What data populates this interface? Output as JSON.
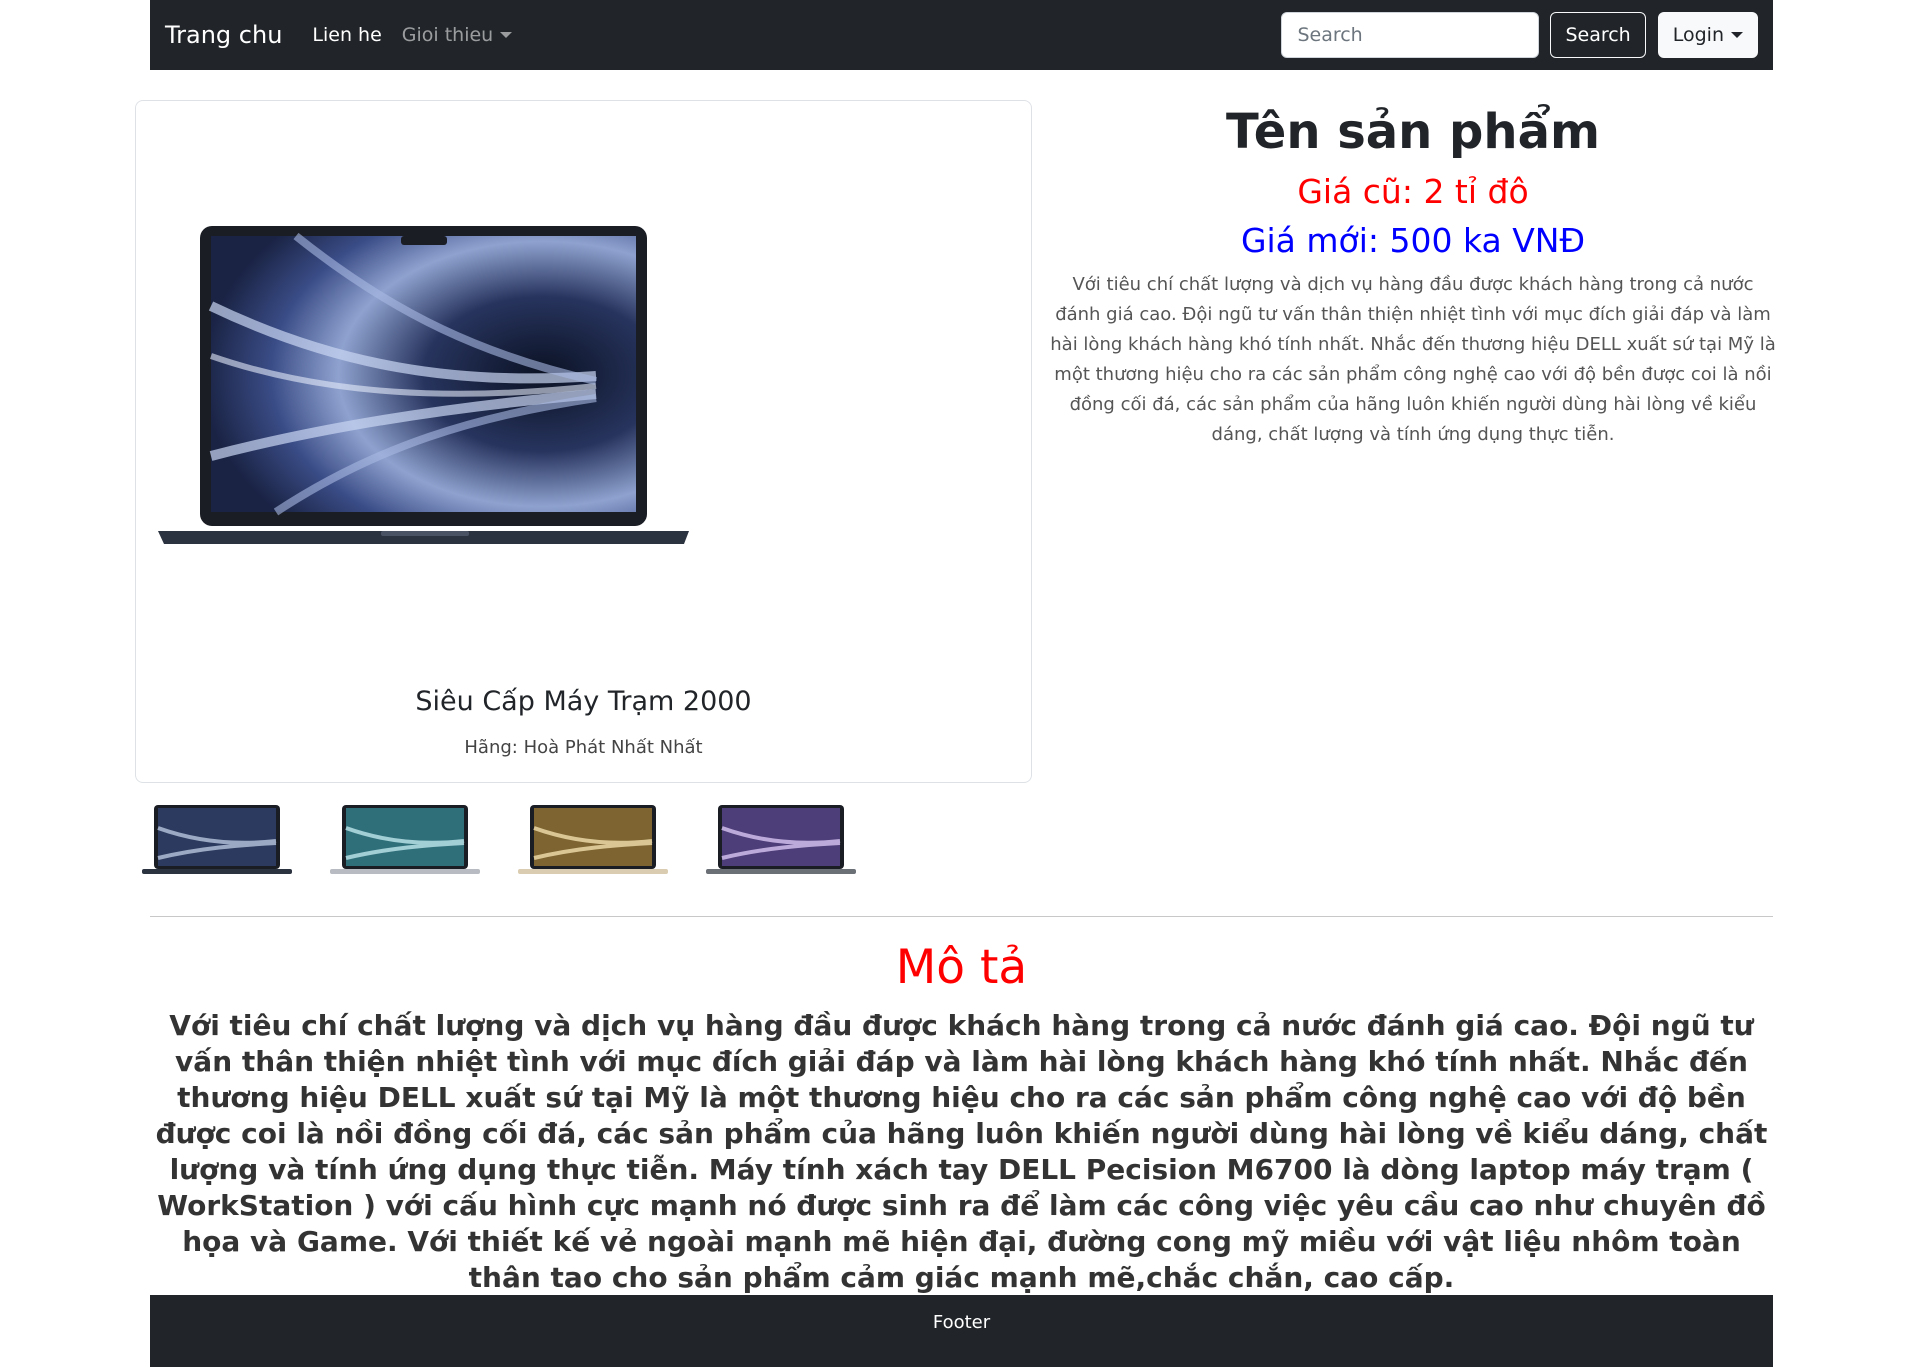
{
  "navbar": {
    "brand": "Trang chu",
    "links": [
      {
        "label": "Lien he"
      },
      {
        "label": "Gioi thieu"
      }
    ],
    "search": {
      "placeholder": "Search",
      "value": "",
      "button_label": "Search"
    },
    "login_label": "Login"
  },
  "product_card": {
    "image": "laptop-macbook-midnight",
    "title": "Siêu Cấp Máy Trạm 2000",
    "brand_line": "Hãng: Hoà Phát Nhất Nhất"
  },
  "thumbnails": [
    {
      "color_name": "midnight",
      "color": "#2b3a5e"
    },
    {
      "color_name": "silver",
      "color": "#7fb7c2"
    },
    {
      "color_name": "starlight",
      "color": "#c9a85f"
    },
    {
      "color_name": "space-gray",
      "color": "#8b6fb8"
    }
  ],
  "info": {
    "name": "Tên sản phẩm",
    "old_price": "Giá cũ: 2 tỉ đô",
    "new_price": "Giá mới: 500 ka VNĐ",
    "short_description": "Với tiêu chí chất lượng và dịch vụ hàng đầu được khách hàng trong cả nước đánh giá cao. Đội ngũ tư vấn thân thiện nhiệt tình với mục đích giải đáp và làm hài lòng khách hàng khó tính nhất. Nhắc đến thương hiệu DELL xuất sứ tại Mỹ là một thương hiệu cho ra các sản phẩm công nghệ cao với độ bền được coi là nồi đồng cối đá, các sản phẩm của hãng luôn khiến người dùng hài lòng về kiểu dáng, chất lượng và tính ứng dụng thực tiễn."
  },
  "description": {
    "title": "Mô tả",
    "body": "Với tiêu chí chất lượng và dịch vụ hàng đầu được khách hàng trong cả nước đánh giá cao. Đội ngũ tư vấn thân thiện nhiệt tình với mục đích giải đáp và làm hài lòng khách hàng khó tính nhất. Nhắc đến thương hiệu DELL xuất sứ tại Mỹ là một thương hiệu cho ra các sản phẩm công nghệ cao với độ bền được coi là nồi đồng cối đá, các sản phẩm của hãng luôn khiến người dùng hài lòng về kiểu dáng, chất lượng và tính ứng dụng thực tiễn. Máy tính xách tay DELL Pecision M6700 là dòng laptop máy trạm ( WorkStation ) với cấu hình cực mạnh nó được sinh ra để làm các công việc yêu cầu cao như chuyên đồ họa và Game. Với thiết kế vẻ ngoài mạnh mẽ hiện đại, đường cong mỹ miều với vật liệu nhôm toàn thân tao cho sản phẩm cảm giác mạnh mẽ,chắc chắn, cao cấp."
  },
  "footer": {
    "label": "Footer"
  },
  "colors": {
    "navbar_bg": "#212529",
    "old_price": "#ff0000",
    "new_price": "#0000ff",
    "description_title": "#ff0000"
  }
}
